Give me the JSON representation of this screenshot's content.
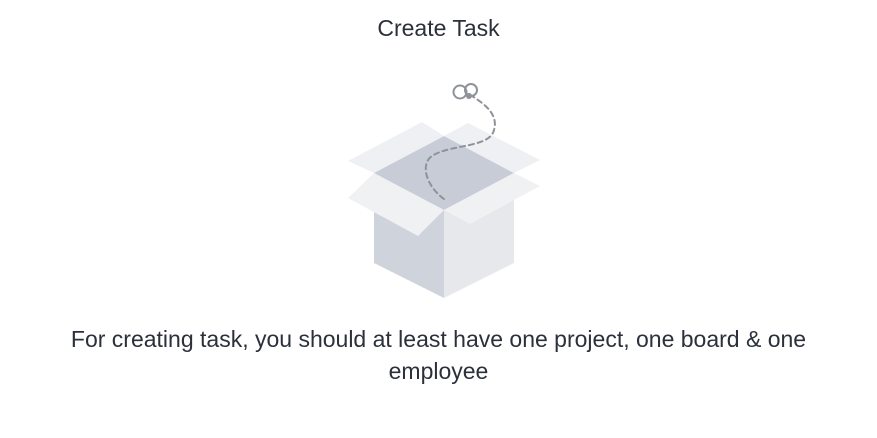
{
  "page": {
    "title": "Create Task",
    "message": "For creating task, you should at least have one project, one board & one employee"
  },
  "illustration": {
    "icon": "empty-box-icon",
    "colors": {
      "box_left": "#cfd3dc",
      "box_right": "#e5e7eb",
      "box_inside": "#c8ccd6",
      "flaps": "#eff0f2",
      "dashed_line": "#8e9299"
    }
  }
}
